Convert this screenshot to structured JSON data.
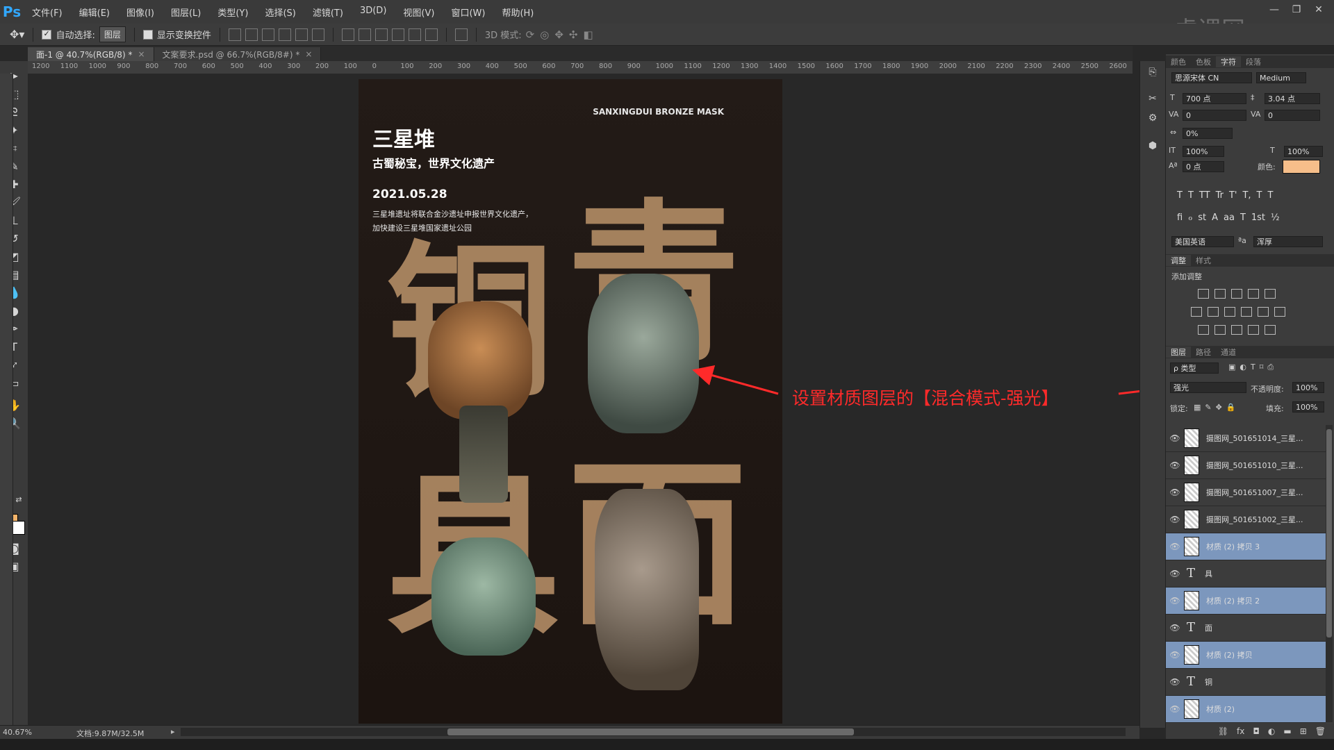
{
  "app": {
    "logo": "Ps",
    "watermark": "虎课网"
  },
  "menu": [
    "文件(F)",
    "编辑(E)",
    "图像(I)",
    "图层(L)",
    "类型(Y)",
    "选择(S)",
    "滤镜(T)",
    "3D(D)",
    "视图(V)",
    "窗口(W)",
    "帮助(H)"
  ],
  "window_controls": [
    "—",
    "❐",
    "✕"
  ],
  "options": {
    "auto_select_label": "自动选择:",
    "auto_select_value": "图层",
    "show_transform_label": "显示变换控件",
    "mode_3d_label": "3D 模式:"
  },
  "tabs": [
    {
      "label": "面-1 @ 40.7%(RGB/8) *",
      "close": "×"
    },
    {
      "label": "文案要求.psd @ 66.7%(RGB/8#) *",
      "close": "×"
    }
  ],
  "ruler_ticks": [
    "1200",
    "1100",
    "1000",
    "900",
    "800",
    "700",
    "600",
    "500",
    "400",
    "300",
    "200",
    "100",
    "0",
    "100",
    "200",
    "300",
    "400",
    "500",
    "600",
    "700",
    "800",
    "900",
    "1000",
    "1100",
    "1200",
    "1300",
    "1400",
    "1500",
    "1600",
    "1700",
    "1800",
    "1900",
    "2000",
    "2100",
    "2200",
    "2300",
    "2400",
    "2500",
    "2600"
  ],
  "poster": {
    "en_title": "SANXINGDUI BRONZE MASK",
    "title": "三星堆",
    "subtitle": "古蜀秘宝，世界文化遗产",
    "date": "2021.05.28",
    "desc_line1": "三星堆遗址将联合金沙遗址申报世界文化遗产，",
    "desc_line2": "加快建设三星堆国家遗址公园",
    "big_chars": [
      "铜",
      "青",
      "具",
      "面"
    ]
  },
  "annotation": {
    "text": "设置材质图层的【混合模式-强光】"
  },
  "character_panel": {
    "tabs": [
      "颜色",
      "色板",
      "字符",
      "段落"
    ],
    "active_tab": "字符",
    "font_family": "思源宋体 CN",
    "font_style": "Medium",
    "font_size": "700 点",
    "leading": "3.04 点",
    "kerning": "0",
    "tracking": "0",
    "scale_pct": "0%",
    "vertical_scale": "100%",
    "horizontal_scale": "100%",
    "baseline_shift": "0 点",
    "color_label": "颜色:",
    "color_value": "#f6be8a",
    "glyphs_row1": [
      "T",
      "T",
      "TT",
      "Tr",
      "T'",
      "T,",
      "T",
      "T"
    ],
    "glyphs_row2": [
      "fi",
      "ℴ",
      "st",
      "A",
      "aa",
      "T",
      "1st",
      "½"
    ],
    "language": "美国英语",
    "aa_label": "ªa",
    "antialias": "浑厚"
  },
  "adjustments_panel": {
    "tabs": [
      "调整",
      "样式"
    ],
    "active_tab": "调整",
    "title": "添加调整"
  },
  "layers_panel": {
    "tabs": [
      "图层",
      "路径",
      "通道"
    ],
    "active_tab": "图层",
    "filter_kind": "ρ 类型",
    "blend_mode": "强光",
    "opacity_label": "不透明度:",
    "opacity": "100%",
    "lock_label": "锁定:",
    "fill_label": "填充:",
    "fill": "100%",
    "layers": [
      {
        "name": "摄图网_501651014_三星...",
        "kind": "image",
        "selected": false
      },
      {
        "name": "摄图网_501651010_三星...",
        "kind": "image",
        "selected": false
      },
      {
        "name": "摄图网_501651007_三星...",
        "kind": "image",
        "selected": false
      },
      {
        "name": "摄图网_501651002_三星...",
        "kind": "image",
        "selected": false
      },
      {
        "name": "材质 (2) 拷贝 3",
        "kind": "image",
        "selected": true
      },
      {
        "name": "具",
        "kind": "text",
        "selected": false
      },
      {
        "name": "材质 (2) 拷贝 2",
        "kind": "image",
        "selected": true
      },
      {
        "name": "面",
        "kind": "text",
        "selected": false
      },
      {
        "name": "材质 (2) 拷贝",
        "kind": "image",
        "selected": true
      },
      {
        "name": "铜",
        "kind": "text",
        "selected": false
      },
      {
        "name": "材质 (2)",
        "kind": "image",
        "selected": true
      }
    ],
    "footer_icons": [
      "link-icon",
      "fx-icon",
      "mask-icon",
      "adjustment-icon",
      "folder-icon",
      "new-layer-icon",
      "trash-icon"
    ]
  },
  "status": {
    "zoom": "40.67%",
    "doc_info": "文档:9.87M/32.5M"
  },
  "colors": {
    "accent": "#31a8ff",
    "annotation": "#ff2a2a",
    "selected_layer": "#7c97bd",
    "foreground": "#f2b36a"
  }
}
